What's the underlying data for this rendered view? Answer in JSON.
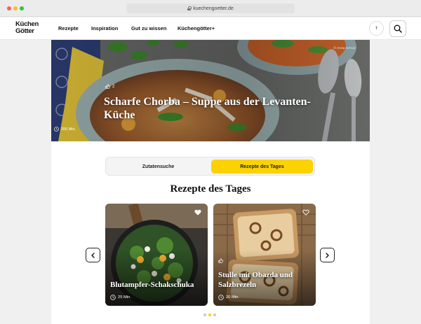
{
  "browser": {
    "url": "kuechengoetter.de"
  },
  "header": {
    "logo_line1": "Küchen",
    "logo_line2": "Götter",
    "nav": [
      "Rezepte",
      "Inspiration",
      "Gut zu wissen",
      "Küchengötter+"
    ],
    "avatar_initial": "T"
  },
  "hero": {
    "credit": "© Anna Schulz",
    "likes": "2",
    "title": "Scharfe Chorba – Suppe aus der Levanten-Küche",
    "time": "200 Min."
  },
  "tabs": {
    "left": "Zutatensuche",
    "right": "Rezepte des Tages",
    "active": "right"
  },
  "section": {
    "title": "Rezepte des Tages"
  },
  "cards": [
    {
      "title": "Blutampfer-Schakschuka",
      "time": "25 Min.",
      "favorited": true
    },
    {
      "title": "Stulle mit Obazda und Salzbrezeln",
      "time": "20 Min.",
      "favorited": false
    }
  ],
  "pagination": {
    "count": 3,
    "active": 1
  },
  "colors": {
    "accent": "#fcd200",
    "text": "#111111"
  },
  "icons": {
    "search": "search-icon",
    "lock": "lock-icon",
    "heart": "heart-icon",
    "clock": "clock-icon",
    "thumb": "thumbs-up-icon",
    "chevron_left": "chevron-left-icon",
    "chevron_right": "chevron-right-icon"
  }
}
